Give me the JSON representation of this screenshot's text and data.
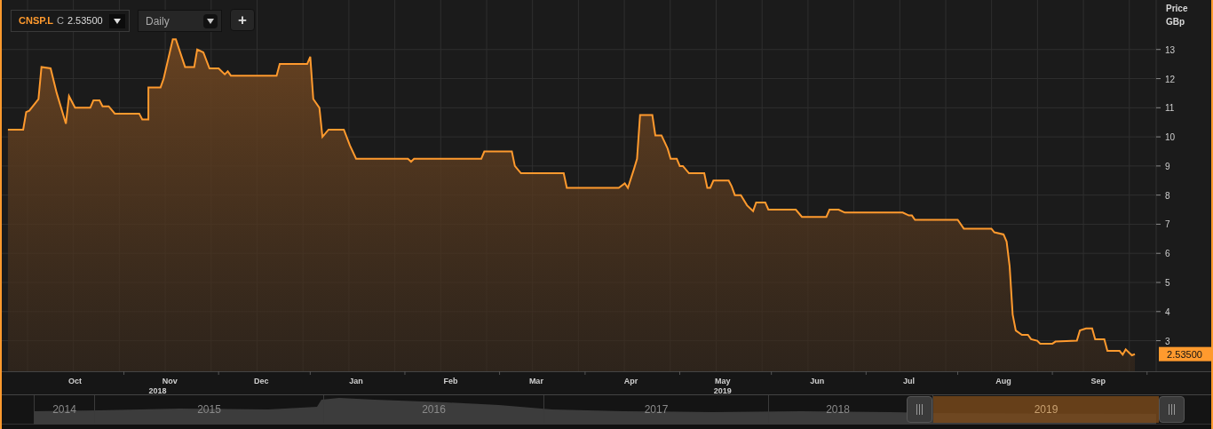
{
  "toolbar": {
    "symbol": "CNSP.L",
    "close_label": "C",
    "close_value": "2.53500",
    "interval": "Daily",
    "add_button": "+"
  },
  "chart": {
    "axis_title": "Price",
    "axis_unit": "GBp",
    "last_price": "2.53500",
    "year_labels": [
      {
        "label": "2018"
      },
      {
        "label": "2019"
      }
    ],
    "chart_data": {
      "type": "area",
      "grid": true,
      "xlim": [
        "2018-09-07",
        "2019-10-08"
      ],
      "ylim": [
        1.95,
        14.7
      ],
      "yticks": [
        3,
        4,
        5,
        6,
        7,
        8,
        9,
        10,
        11,
        12,
        13
      ],
      "xticks": [
        {
          "value": "2018-10-01",
          "label": "Oct"
        },
        {
          "value": "2018-11-01",
          "label": "Nov"
        },
        {
          "value": "2018-12-01",
          "label": "Dec"
        },
        {
          "value": "2019-01-01",
          "label": "Jan"
        },
        {
          "value": "2019-02-01",
          "label": "Feb"
        },
        {
          "value": "2019-03-01",
          "label": "Mar"
        },
        {
          "value": "2019-04-01",
          "label": "Apr"
        },
        {
          "value": "2019-05-01",
          "label": "May"
        },
        {
          "value": "2019-06-01",
          "label": "Jun"
        },
        {
          "value": "2019-07-01",
          "label": "Jul"
        },
        {
          "value": "2019-08-01",
          "label": "Aug"
        },
        {
          "value": "2019-09-01",
          "label": "Sep"
        }
      ],
      "x": [
        "2018-09-09",
        "2018-09-14",
        "2018-09-15",
        "2018-09-16",
        "2018-09-19",
        "2018-09-20",
        "2018-09-23",
        "2018-09-25",
        "2018-09-28",
        "2018-09-29",
        "2018-10-01",
        "2018-10-06",
        "2018-10-07",
        "2018-10-09",
        "2018-10-10",
        "2018-10-12",
        "2018-10-14",
        "2018-10-22",
        "2018-10-23",
        "2018-10-25",
        "2018-10-25",
        "2018-10-29",
        "2018-10-30",
        "2018-11-02",
        "2018-11-03",
        "2018-11-06",
        "2018-11-09",
        "2018-11-10",
        "2018-11-12",
        "2018-11-14",
        "2018-11-17",
        "2018-11-19",
        "2018-11-20",
        "2018-11-21",
        "2018-12-06",
        "2018-12-07",
        "2018-12-16",
        "2018-12-17",
        "2018-12-18",
        "2018-12-20",
        "2018-12-21",
        "2018-12-23",
        "2018-12-28",
        "2018-12-30",
        "2019-01-01",
        "2019-01-18",
        "2019-01-19",
        "2019-01-20",
        "2019-02-11",
        "2019-02-12",
        "2019-02-21",
        "2019-02-22",
        "2019-02-24",
        "2019-03-10",
        "2019-03-11",
        "2019-03-28",
        "2019-03-30",
        "2019-03-31",
        "2019-04-02",
        "2019-04-03",
        "2019-04-04",
        "2019-04-08",
        "2019-04-09",
        "2019-04-11",
        "2019-04-13",
        "2019-04-14",
        "2019-04-16",
        "2019-04-17",
        "2019-04-18",
        "2019-04-20",
        "2019-04-25",
        "2019-04-26",
        "2019-04-27",
        "2019-04-28",
        "2019-05-03",
        "2019-05-04",
        "2019-05-05",
        "2019-05-07",
        "2019-05-09",
        "2019-05-11",
        "2019-05-12",
        "2019-05-15",
        "2019-05-16",
        "2019-05-25",
        "2019-05-27",
        "2019-06-04",
        "2019-06-05",
        "2019-06-08",
        "2019-06-10",
        "2019-06-29",
        "2019-07-01",
        "2019-07-02",
        "2019-07-03",
        "2019-07-17",
        "2019-07-19",
        "2019-07-28",
        "2019-07-29",
        "2019-08-01",
        "2019-08-02",
        "2019-08-03",
        "2019-08-04",
        "2019-08-05",
        "2019-08-07",
        "2019-08-09",
        "2019-08-10",
        "2019-08-12",
        "2019-08-13",
        "2019-08-17",
        "2019-08-18",
        "2019-08-25",
        "2019-08-26",
        "2019-08-28",
        "2019-08-30",
        "2019-08-31",
        "2019-09-03",
        "2019-09-04",
        "2019-09-08",
        "2019-09-09",
        "2019-09-10",
        "2019-09-12",
        "2019-09-13"
      ],
      "series": [
        {
          "color": "#ff9a2e",
          "values": [
            10.25,
            10.25,
            10.85,
            10.9,
            11.3,
            12.4,
            12.35,
            11.5,
            10.45,
            11.4,
            11.0,
            11.0,
            11.25,
            11.25,
            11.05,
            11.05,
            10.8,
            10.8,
            10.6,
            10.6,
            11.7,
            11.7,
            12.0,
            13.35,
            13.35,
            12.4,
            12.4,
            13.0,
            12.9,
            12.35,
            12.35,
            12.15,
            12.25,
            12.1,
            12.1,
            12.5,
            12.5,
            12.75,
            11.3,
            11.0,
            10.0,
            10.25,
            10.25,
            9.7,
            9.25,
            9.25,
            9.15,
            9.25,
            9.25,
            9.5,
            9.5,
            9.0,
            8.75,
            8.75,
            8.25,
            8.25,
            8.4,
            8.25,
            8.9,
            9.25,
            10.75,
            10.75,
            10.05,
            10.05,
            9.6,
            9.25,
            9.25,
            9.0,
            9.0,
            8.75,
            8.75,
            8.25,
            8.25,
            8.5,
            8.5,
            8.3,
            8.0,
            8.0,
            7.65,
            7.45,
            7.75,
            7.75,
            7.5,
            7.5,
            7.25,
            7.25,
            7.5,
            7.5,
            7.4,
            7.4,
            7.3,
            7.3,
            7.15,
            7.15,
            6.85,
            6.85,
            6.72,
            6.65,
            6.4,
            5.55,
            3.9,
            3.35,
            3.2,
            3.2,
            3.05,
            3.0,
            2.9,
            2.9,
            2.97,
            3.0,
            3.35,
            3.42,
            3.42,
            3.05,
            3.05,
            2.65,
            2.65,
            2.52,
            2.7,
            2.5,
            2.54
          ]
        }
      ]
    }
  },
  "navigator": {
    "years": [
      {
        "label": "2014",
        "selected": false
      },
      {
        "label": "2015",
        "selected": false
      },
      {
        "label": "2016",
        "selected": false
      },
      {
        "label": "2017",
        "selected": false
      },
      {
        "label": "2018",
        "selected": false
      },
      {
        "label": "2019",
        "selected": true
      }
    ]
  }
}
